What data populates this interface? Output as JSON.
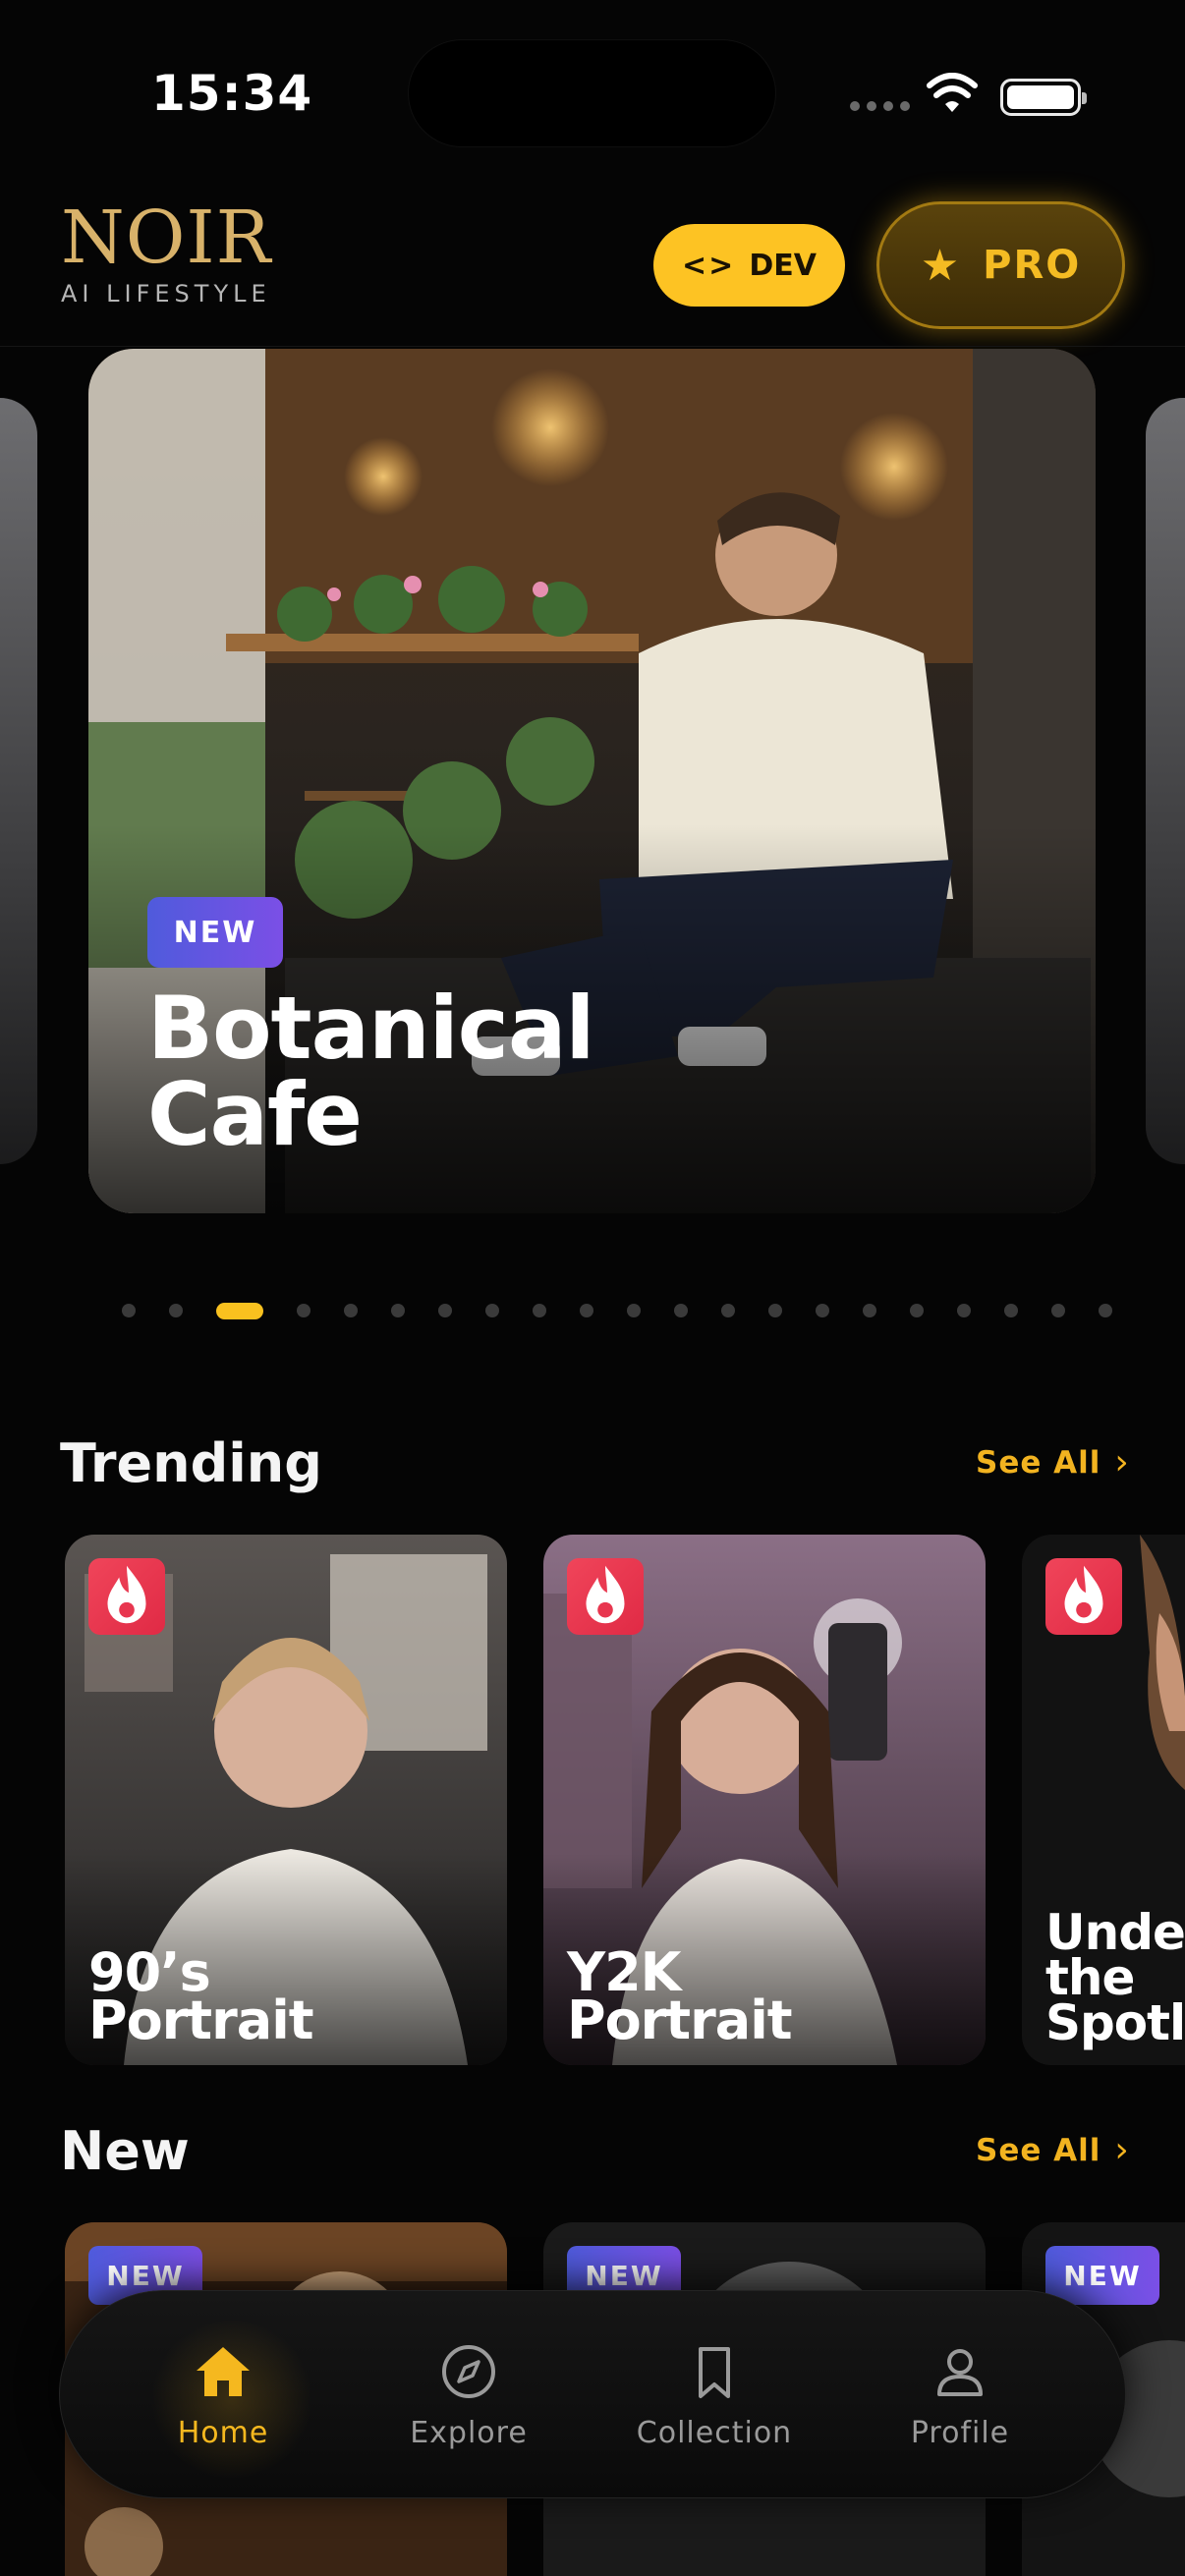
{
  "status_bar": {
    "time": "15:34"
  },
  "header": {
    "logo_word": "NOIR",
    "logo_sub": "AI LIFESTYLE",
    "dev_label": "DEV",
    "dev_icon": "code-icon",
    "pro_label": "PRO",
    "pro_icon": "star-icon"
  },
  "hero": {
    "tag": "NEW",
    "title": "Botanical\nCafe",
    "page_count": 21,
    "active_page": 3
  },
  "trending": {
    "title": "Trending",
    "see_all": "See All",
    "cards": [
      {
        "title": "90’s\nPortrait",
        "icon": "flame-icon"
      },
      {
        "title": "Y2K\nPortrait",
        "icon": "flame-icon"
      },
      {
        "title": "Under\nthe\nSpotli",
        "icon": "flame-icon"
      }
    ]
  },
  "new_section": {
    "title": "New",
    "see_all": "See All",
    "cards": [
      {
        "tag": "NEW"
      },
      {
        "tag": "NEW"
      },
      {
        "tag": "NEW"
      }
    ]
  },
  "nav": {
    "items": [
      {
        "label": "Home",
        "icon": "home-icon",
        "active": true
      },
      {
        "label": "Explore",
        "icon": "compass-icon",
        "active": false
      },
      {
        "label": "Collection",
        "icon": "bookmark-icon",
        "active": false
      },
      {
        "label": "Profile",
        "icon": "user-icon",
        "active": false
      }
    ]
  },
  "colors": {
    "accent": "#f5b81f",
    "background": "#050505",
    "new_tag": "#5b5ee0",
    "fire_tag": "#e8364f"
  }
}
